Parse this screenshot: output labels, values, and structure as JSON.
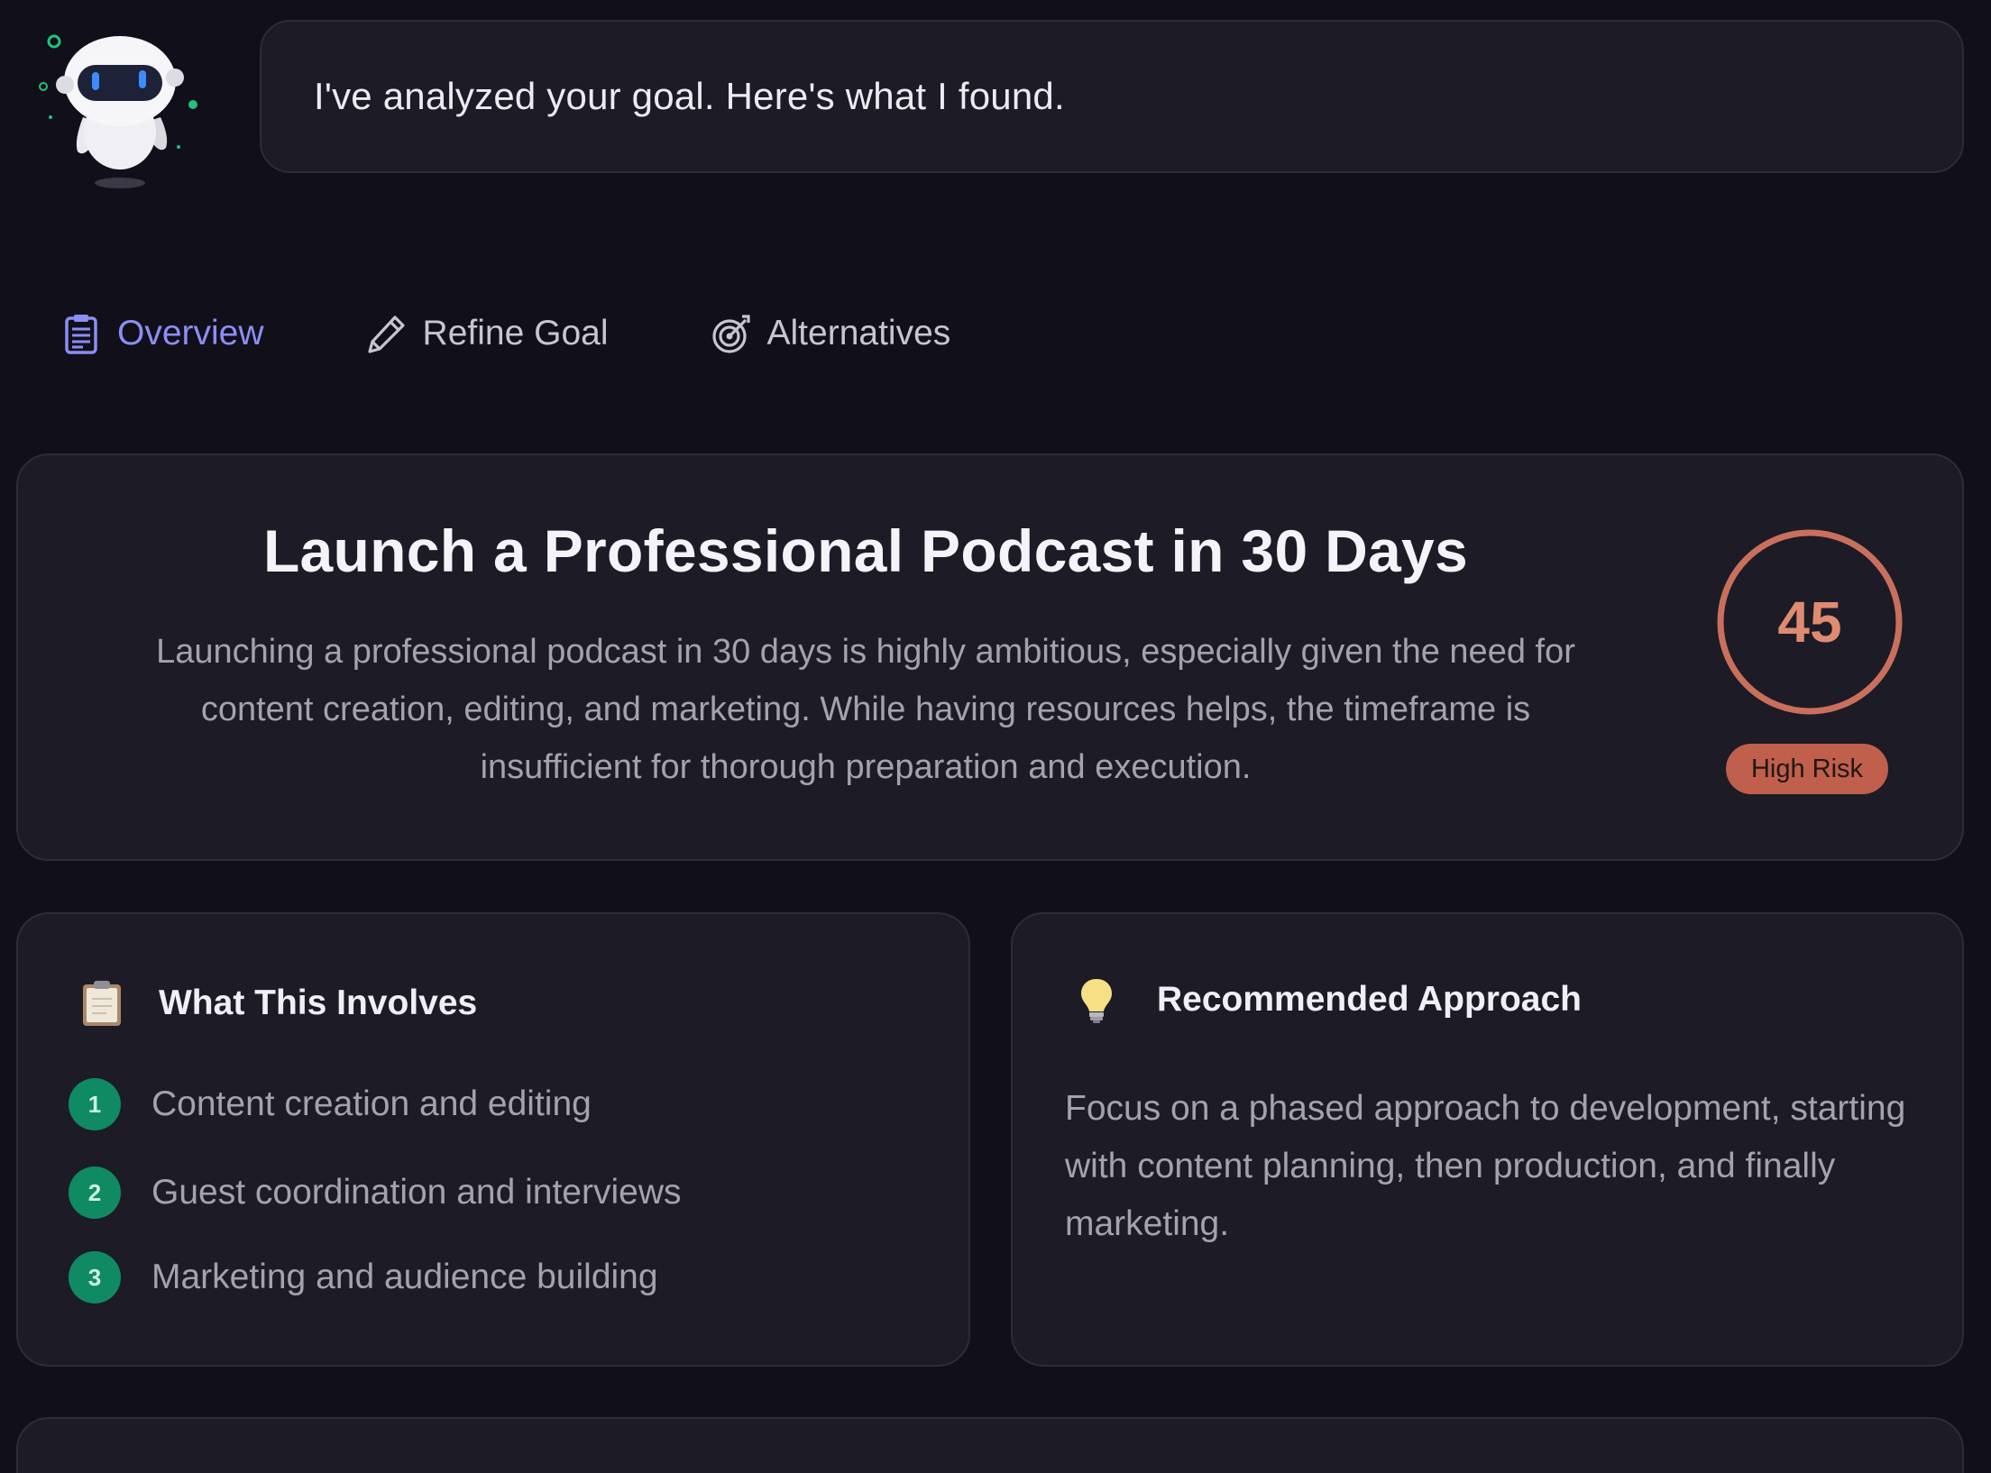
{
  "assistant": {
    "avatar_icon": "robot-icon",
    "message": "I've analyzed your goal. Here's what I found."
  },
  "tabs": [
    {
      "label": "Overview",
      "icon": "clipboard-icon",
      "active": true
    },
    {
      "label": "Refine Goal",
      "icon": "pencil-icon",
      "active": false
    },
    {
      "label": "Alternatives",
      "icon": "target-icon",
      "active": false
    }
  ],
  "goal": {
    "title": "Launch a Professional Podcast in 30 Days",
    "description": "Launching a professional podcast in 30 days is highly ambitious, especially given the need for content creation, editing, and marketing. While having resources helps, the timeframe is insufficient for thorough preparation and execution.",
    "score": "45",
    "score_fraction": 0.45,
    "risk_label": "High Risk",
    "risk_color": "#bf5f4c"
  },
  "involves": {
    "icon": "clipboard-emoji-icon",
    "title": "What This Involves",
    "items": [
      {
        "num": "1",
        "text": "Content creation and editing"
      },
      {
        "num": "2",
        "text": "Guest coordination and interviews"
      },
      {
        "num": "3",
        "text": "Marketing and audience building"
      }
    ]
  },
  "approach": {
    "icon": "lightbulb-icon",
    "title": "Recommended Approach",
    "text": "Focus on a phased approach to development, starting with content planning, then production, and finally marketing."
  },
  "colors": {
    "accent": "#8b8ff2",
    "step_badge": "#0f8a63",
    "score": "#df8b70",
    "background": "#110f1a",
    "card": "#1c1b26"
  }
}
